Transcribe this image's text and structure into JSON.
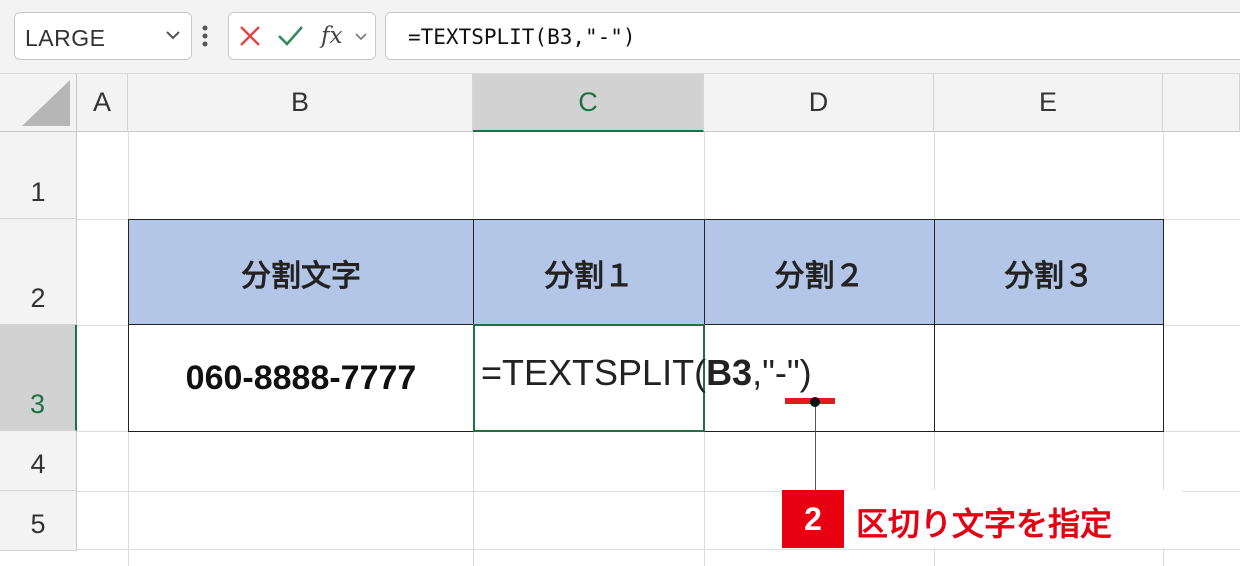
{
  "formula_bar": {
    "name_box": "LARGE",
    "fx_label": "fx",
    "formula": "=TEXTSPLIT(B3,\"-\")"
  },
  "columns": [
    "A",
    "B",
    "C",
    "D",
    "E"
  ],
  "rows": [
    "1",
    "2",
    "3",
    "4",
    "5"
  ],
  "table": {
    "headers": [
      "分割文字",
      "分割１",
      "分割２",
      "分割３"
    ],
    "source_value": "060-8888-7777",
    "cell_formula": {
      "prefix": "=TEXTSPLIT(",
      "ref": "B3",
      "rest": ",\"-\")"
    }
  },
  "annotation": {
    "number": "2",
    "text": "区切り文字を指定"
  },
  "colors": {
    "header_fill": "#b4c6e7",
    "selection_green": "#1e7145",
    "annotation_red": "#e60012"
  }
}
